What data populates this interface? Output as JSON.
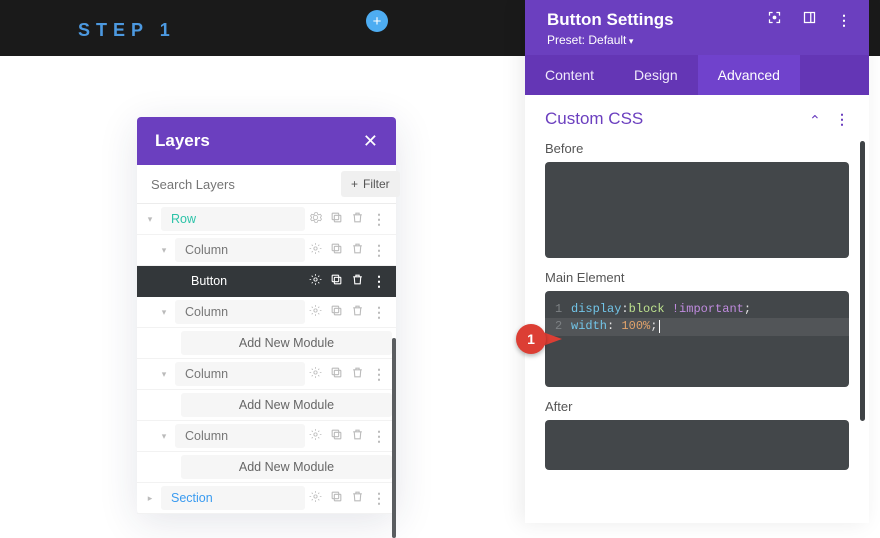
{
  "step_label": "STEP 1",
  "layers": {
    "title": "Layers",
    "search_placeholder": "Search Layers",
    "filter_label": "Filter",
    "rows": {
      "row": "Row",
      "column": "Column",
      "button": "Button",
      "add_module": "Add New Module",
      "section": "Section"
    }
  },
  "settings": {
    "title": "Button Settings",
    "preset": "Preset: Default",
    "tabs": {
      "content": "Content",
      "design": "Design",
      "advanced": "Advanced"
    },
    "section_title": "Custom CSS",
    "labels": {
      "before": "Before",
      "main": "Main Element",
      "after": "After"
    }
  },
  "css_main": {
    "l1": {
      "prop": "display",
      "val": "block",
      "imp": "!important"
    },
    "l2": {
      "prop": "width",
      "num": "100%"
    }
  },
  "gutter": {
    "one": "1",
    "two": "2"
  },
  "callout1": "1",
  "chart_data": null
}
